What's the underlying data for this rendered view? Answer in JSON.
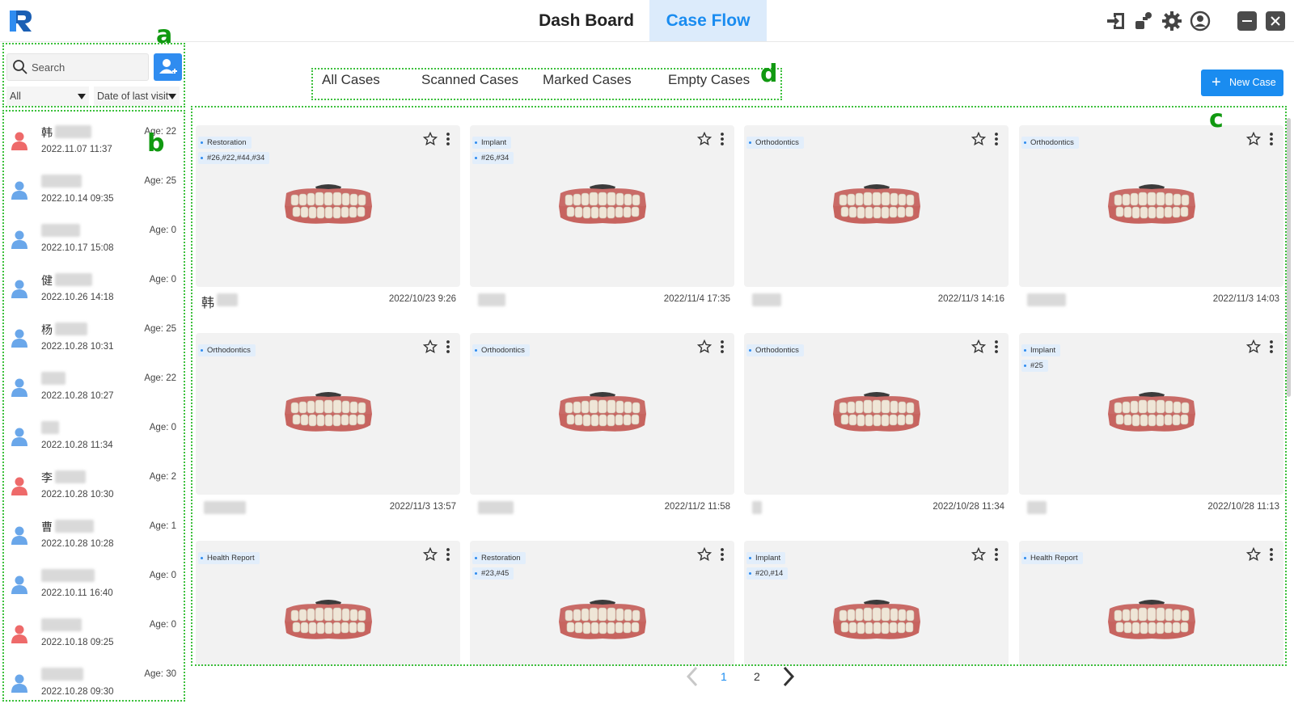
{
  "header": {
    "nav_tabs": [
      {
        "label": "Dash Board",
        "active": false
      },
      {
        "label": "Case Flow",
        "active": true
      }
    ],
    "toolbar_icons": [
      "import-icon",
      "share-icon",
      "gear-icon",
      "user-account-icon"
    ],
    "window_controls": [
      "minimize-icon",
      "close-icon"
    ],
    "active_color": "#1a8cf0"
  },
  "sidebar": {
    "search": {
      "placeholder": "Search",
      "value": ""
    },
    "filter_all": "All",
    "sort_by": "Date of last visit",
    "patients": [
      {
        "name": "韩",
        "date": "2022.11.07 11:37",
        "age": "Age: 22",
        "gender": "female"
      },
      {
        "name": "",
        "date": "2022.10.14 09:35",
        "age": "Age: 25",
        "gender": "male"
      },
      {
        "name": "",
        "date": "2022.10.17 15:08",
        "age": "Age: 0",
        "gender": "male"
      },
      {
        "name": "健",
        "date": "2022.10.26 14:18",
        "age": "Age: 0",
        "gender": "male"
      },
      {
        "name": "杨",
        "date": "2022.10.28 10:31",
        "age": "Age: 25",
        "gender": "male"
      },
      {
        "name": "",
        "date": "2022.10.28 10:27",
        "age": "Age: 22",
        "gender": "male"
      },
      {
        "name": "",
        "date": "2022.10.28 11:34",
        "age": "Age: 0",
        "gender": "male"
      },
      {
        "name": "李",
        "date": "2022.10.28 10:30",
        "age": "Age: 2",
        "gender": "female"
      },
      {
        "name": "曹",
        "date": "2022.10.28 10:28",
        "age": "Age: 1",
        "gender": "male"
      },
      {
        "name": "",
        "date": "2022.10.11 16:40",
        "age": "Age: 0",
        "gender": "male"
      },
      {
        "name": "",
        "date": "2022.10.18 09:25",
        "age": "Age: 0",
        "gender": "female"
      },
      {
        "name": "",
        "date": "2022.10.28 09:30",
        "age": "Age: 30",
        "gender": "male"
      }
    ]
  },
  "case_tabs": [
    "All Cases",
    "Scanned Cases",
    "Marked Cases",
    "Empty Cases"
  ],
  "new_case_label": "New Case",
  "cases": [
    {
      "tags": [
        "Restoration",
        "#26,#22,#44,#34"
      ],
      "name": "韩",
      "date": "2022/10/23 9:26"
    },
    {
      "tags": [
        "Implant",
        "#26,#34"
      ],
      "name": "",
      "date": "2022/11/4 17:35"
    },
    {
      "tags": [
        "Orthodontics"
      ],
      "name": "",
      "date": "2022/11/3 14:16"
    },
    {
      "tags": [
        "Orthodontics"
      ],
      "name": "",
      "date": "2022/11/3 14:03"
    },
    {
      "tags": [
        "Orthodontics"
      ],
      "name": "",
      "date": "2022/11/3 13:57"
    },
    {
      "tags": [
        "Orthodontics"
      ],
      "name": "",
      "date": "2022/11/2 11:58"
    },
    {
      "tags": [
        "Orthodontics"
      ],
      "name": "",
      "date": "2022/10/28 11:34"
    },
    {
      "tags": [
        "Implant",
        "#25"
      ],
      "name": "",
      "date": "2022/10/28 11:13"
    },
    {
      "tags": [
        "Health Report"
      ],
      "name": "",
      "date": ""
    },
    {
      "tags": [
        "Restoration",
        "#23,#45"
      ],
      "name": "",
      "date": ""
    },
    {
      "tags": [
        "Implant",
        "#20,#14"
      ],
      "name": "",
      "date": ""
    },
    {
      "tags": [
        "Health Report"
      ],
      "name": "",
      "date": ""
    }
  ],
  "pagination": {
    "pages": [
      "1",
      "2"
    ],
    "current": "1"
  },
  "annotations": [
    "a",
    "b",
    "c",
    "d"
  ]
}
